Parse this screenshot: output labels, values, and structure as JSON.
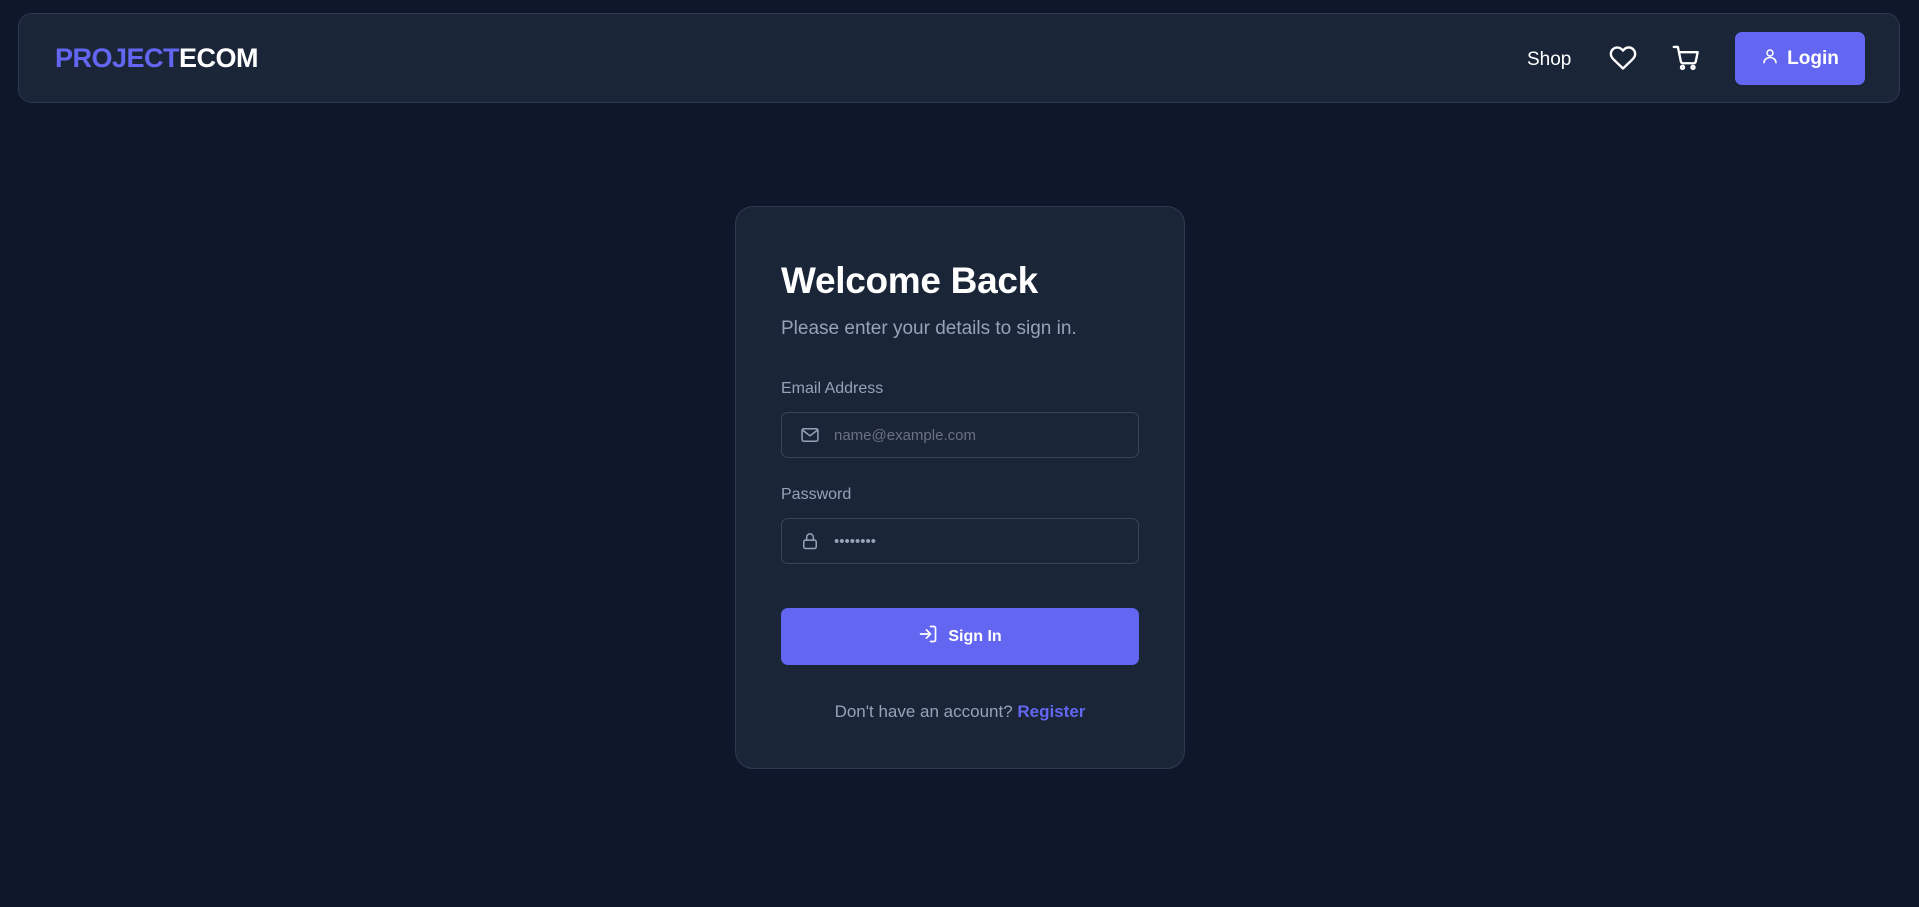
{
  "header": {
    "logo_part1": "PROJECT",
    "logo_part2": "ECOM",
    "nav_shop": "Shop",
    "wishlist_icon": "heart-icon",
    "cart_icon": "cart-icon",
    "login_icon": "user-icon",
    "login_label": "Login"
  },
  "login_form": {
    "title": "Welcome Back",
    "subtitle": "Please enter your details to sign in.",
    "email_label": "Email Address",
    "email_placeholder": "name@example.com",
    "email_icon": "mail-icon",
    "password_label": "Password",
    "password_value": "••••••••",
    "password_icon": "lock-icon",
    "submit_label": "Sign In",
    "submit_icon": "sign-in-icon",
    "register_prompt": "Don't have an account?",
    "register_link": "Register"
  },
  "colors": {
    "background": "#0f172a",
    "surface": "#1b2538",
    "accent": "#6366f1",
    "muted_text": "#94a3b8"
  }
}
